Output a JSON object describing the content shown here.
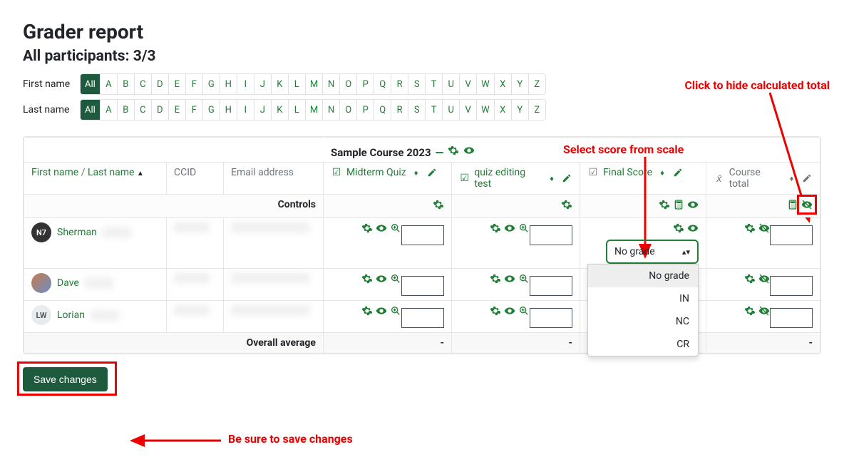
{
  "page": {
    "title": "Grader report",
    "subtitle": "All participants: 3/3",
    "firstNameLabel": "First name",
    "lastNameLabel": "Last name"
  },
  "filters": {
    "allLabel": "All",
    "letters": [
      "A",
      "B",
      "C",
      "D",
      "E",
      "F",
      "G",
      "H",
      "I",
      "J",
      "K",
      "L",
      "M",
      "N",
      "O",
      "P",
      "Q",
      "R",
      "S",
      "T",
      "U",
      "V",
      "W",
      "X",
      "Y",
      "Z"
    ]
  },
  "table": {
    "courseTitle": "Sample Course 2023",
    "headers": {
      "firstName": "First name",
      "lastName": "Last name",
      "ccid": "CCID",
      "email": "Email address",
      "midterm": "Midterm Quiz",
      "quizEditing": "quiz editing test",
      "finalScore": "Final Score",
      "courseTotal": "Course total"
    },
    "controlsLabel": "Controls",
    "overallAverage": "Overall average",
    "dash": "-"
  },
  "students": [
    {
      "avatarText": "N7",
      "avatarClass": "",
      "name": "Sherman"
    },
    {
      "avatarText": "",
      "avatarClass": "photo",
      "name": "Dave"
    },
    {
      "avatarText": "LW",
      "avatarClass": "lw",
      "name": "Lorian"
    }
  ],
  "scaleDropdown": {
    "selected": "No grade",
    "options": [
      "No grade",
      "IN",
      "NC",
      "CR"
    ]
  },
  "annotations": {
    "hideTotal": "Click to hide calculated total",
    "selectScore": "Select score from scale",
    "saveChanges": "Be sure to save changes"
  },
  "buttons": {
    "save": "Save changes"
  },
  "icons": {
    "gear": "gear",
    "eye": "eye",
    "eyeOff": "eye-off",
    "zoom": "zoom",
    "pencil": "pencil",
    "calc": "calculator",
    "minus": "minus",
    "check": "checkbox",
    "xbar": "xbar",
    "sort": "sort"
  }
}
